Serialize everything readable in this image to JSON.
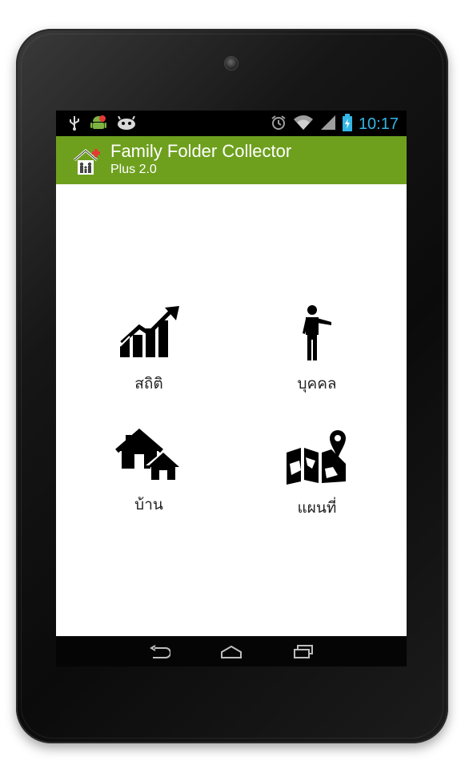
{
  "status_bar": {
    "time": "10:17",
    "left_icons": [
      "usb-icon",
      "android-icon",
      "notification-icon"
    ],
    "right_icons": [
      "alarm-icon",
      "wifi-icon",
      "signal-icon",
      "battery-charging-icon"
    ],
    "accent_color": "#33b5e5"
  },
  "action_bar": {
    "title": "Family Folder Collector",
    "subtitle": "Plus 2.0",
    "background_color": "#6ea01e"
  },
  "menu": {
    "items": [
      {
        "label": "สถิติ",
        "icon": "statistics-chart-icon"
      },
      {
        "label": "บุคคล",
        "icon": "person-icon"
      },
      {
        "label": "บ้าน",
        "icon": "house-icon"
      },
      {
        "label": "แผนที่",
        "icon": "map-icon"
      }
    ]
  },
  "nav_bar": {
    "buttons": [
      "back-icon",
      "home-icon",
      "recent-apps-icon"
    ]
  }
}
